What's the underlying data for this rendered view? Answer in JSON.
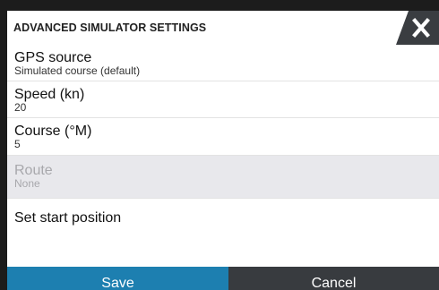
{
  "dialog": {
    "title": "ADVANCED SIMULATOR SETTINGS",
    "close_icon": "close-icon"
  },
  "settings": [
    {
      "label": "GPS source",
      "value": "Simulated course (default)",
      "enabled": true
    },
    {
      "label": "Speed (kn)",
      "value": "20",
      "enabled": true
    },
    {
      "label": "Course (°M)",
      "value": "5",
      "enabled": true
    },
    {
      "label": "Route",
      "value": "None",
      "enabled": false
    },
    {
      "label": "Set start position",
      "enabled": true
    }
  ],
  "footer": {
    "save_label": "Save",
    "cancel_label": "Cancel"
  },
  "colors": {
    "save_button": "#1d7fb0",
    "cancel_button": "#383b3f",
    "close_tab": "#3a3d41",
    "disabled_row": "#e8e8ec"
  }
}
